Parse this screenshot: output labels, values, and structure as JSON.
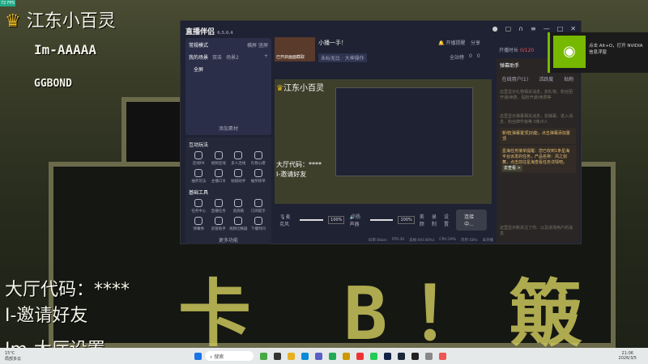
{
  "overlay": {
    "title": "江东小百灵",
    "line1": "Im-AAAAA",
    "line2": "GGBOND",
    "lobby": "大厅代码：****",
    "invite": "I-邀请好友",
    "settings": "Im-大厅设置",
    "big_text": "卡 B！簸",
    "fps": "72 FPS"
  },
  "app": {
    "name": "直播伴侣",
    "version": "6.5.6.4",
    "mode": "常规模式",
    "mode_opts": [
      "横屏",
      "竖屏"
    ],
    "scene_tabs": [
      "我的场景",
      "双击",
      "场景2"
    ],
    "scene_item": "全屏",
    "add_source": "添加素材",
    "stream_title": "小播一手！",
    "cover_label": "已开启画面截取",
    "tags": "未标无比 · 大神操作",
    "notice": "开播提醒",
    "share": "分享",
    "stats": [
      "全站榜",
      "0",
      "0"
    ],
    "interactive_title": "互动玩法",
    "interactive": [
      "连线PK",
      "视频连线",
      "多人连线",
      "礼物心愿",
      "抽奖玩法",
      "主播口令",
      "贴纸助手",
      "抽奖榜单"
    ],
    "tools_title": "基础工具",
    "tools": [
      "任务中心",
      "直播任务",
      "道具箱",
      "订阅提示",
      "弹幕秀",
      "房管助手",
      "视频切换器",
      "下播时间"
    ],
    "tools_badge": "1",
    "more": "更多功能",
    "mic": "麦克风",
    "speaker": "扬声器",
    "mic_vol": "100%",
    "spk_vol": "100%",
    "beauty": "美颜",
    "record": "录制",
    "settings": "设置",
    "live_btn": "连接中...",
    "status": [
      "码率:0kb/s",
      "FPS:30",
      "丢帧:0(0.00%)",
      "CPU:29%",
      "内存:58%",
      "未开播"
    ],
    "duration_label": "开播时长",
    "duration": "0/120",
    "assistant": "弹幕助手",
    "assistant_tabs": [
      "在线用户(1)",
      "活跃度",
      "贴粉"
    ],
    "msg1": "这里显示礼物相关消息，如礼物、粉丝团开通/续费、贴粉开通/续费等",
    "msg2": "这里显示弹幕相关消息，如弹幕、进入消息、粉丝牌升级等",
    "unread": "0条/0人",
    "tip1": "新增[弹幕置顶]功能，点击弹幕添加置顶",
    "tip2": "星海任务接单提醒：您已收到1条星海平台派发的任务，产品名称：风之剑舞，点击前往星海查看任务详情吧。",
    "tip_btn": "去查看 >",
    "msg3": "这里显示新关注了你、以及进场用户的消息"
  },
  "nvidia": {
    "text": "点击 Alt+O，打开 NVIDIA 信息浮窗"
  },
  "taskbar": {
    "temp": "15°C",
    "weather": "局部多云",
    "search": "搜索",
    "time": "21:06",
    "date": "2026/3/5"
  }
}
